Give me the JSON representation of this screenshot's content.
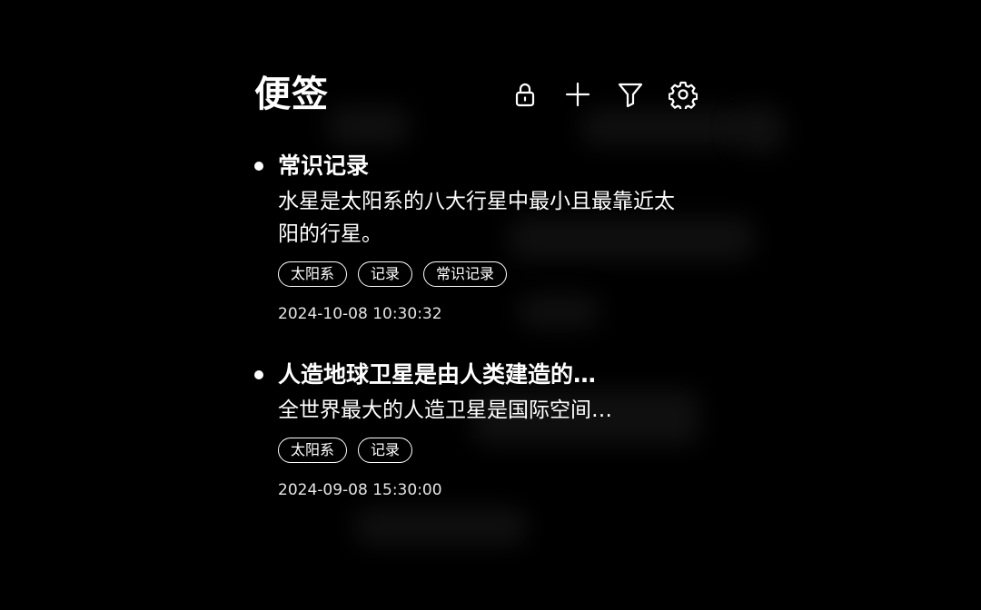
{
  "header": {
    "title": "便签",
    "icons": [
      "lock-icon",
      "plus-icon",
      "filter-icon",
      "gear-icon"
    ]
  },
  "notes": [
    {
      "title": "常识记录",
      "body": "水星是太阳系的八大行星中最小且最靠近太阳的行星。",
      "tags": [
        "太阳系",
        "记录",
        "常识记录"
      ],
      "date": "2024-10-08 10:30:32"
    },
    {
      "title": "人造地球卫星是由人类建造的…",
      "body": "全世界最大的人造卫星是国际空间…",
      "tags": [
        "太阳系",
        "记录"
      ],
      "date": "2024-09-08 15:30:00"
    }
  ],
  "colors": {
    "background": "#000000",
    "foreground": "#ffffff"
  }
}
